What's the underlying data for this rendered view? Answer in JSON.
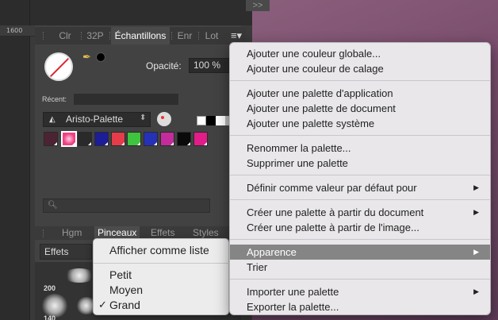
{
  "ruler": {
    "value": "1600"
  },
  "tabs": [
    "Clr",
    "32P",
    "Échantillons",
    "Enr",
    "Lot"
  ],
  "panel_menu_icon": "menu-icon",
  "collapse_label": ">>",
  "opacity": {
    "label": "Opacité:",
    "value": "100 %"
  },
  "recent_label": "Récent:",
  "palette": {
    "name": "Aristo-Palette",
    "icon": "artist-palette-icon"
  },
  "swatches": [
    "#4b2332",
    "#ef3f82",
    "#2a2a2a",
    "#1c1d97",
    "#e43c4a",
    "#3ec43e",
    "#2532b8",
    "#c42c9c",
    "#0a0a0a",
    "#e21c88"
  ],
  "search_placeholder": "",
  "bottom_tabs": [
    "Hgm",
    "Pinceaux",
    "Effets",
    "Styles"
  ],
  "effets_select": "Effets",
  "brush_sizes": [
    "200",
    "140"
  ],
  "small_menu": {
    "items": [
      "Afficher comme liste",
      "Petit",
      "Moyen",
      "Grand"
    ],
    "checked": "Grand",
    "check_mark": "✓"
  },
  "main_menu": {
    "groups": [
      [
        "Ajouter une couleur globale...",
        "Ajouter une couleur de calage"
      ],
      [
        "Ajouter une palette d'application",
        "Ajouter une palette de document",
        "Ajouter une palette système"
      ],
      [
        "Renommer la palette...",
        "Supprimer une palette"
      ],
      [
        "Définir comme valeur par défaut pour"
      ],
      [
        "Créer une palette à partir du document",
        "Créer une palette à partir de l'image..."
      ],
      [
        "Apparence",
        "Trier"
      ],
      [
        "Importer une palette",
        "Exporter la palette..."
      ]
    ],
    "highlighted": "Apparence",
    "submenu_arrow": "▶"
  }
}
